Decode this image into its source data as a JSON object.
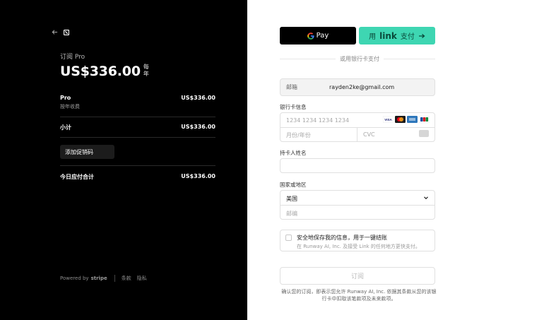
{
  "summary": {
    "subscribe_label": "订阅 Pro",
    "price": "US$336.00",
    "per": "每年",
    "items": [
      {
        "name": "Pro",
        "sub": "按年收费",
        "amount": "US$336.00"
      }
    ],
    "subtotal_label": "小计",
    "subtotal_amount": "US$336.00",
    "promo_label": "添加促销码",
    "total_label": "今日应付合计",
    "total_amount": "US$336.00"
  },
  "footer": {
    "powered_by": "Powered by",
    "stripe": "stripe",
    "terms": "条款",
    "privacy": "隐私"
  },
  "payment": {
    "gpay_label": "Pay",
    "link_prefix": "用",
    "link_brand": "link",
    "link_suffix": "支付",
    "or_text": "或用银行卡支付",
    "email_label": "邮箱",
    "email_value": "rayden2ke@gmail.com",
    "card_label": "银行卡信息",
    "card_placeholder": "1234 1234 1234 1234",
    "expiry_placeholder": "月份/年份",
    "cvc_placeholder": "CVC",
    "name_label": "持卡人姓名",
    "name_value": "",
    "country_label": "国家或地区",
    "country_value": "美国",
    "zip_placeholder": "邮编",
    "save_title": "安全地保存我的信息，用于一键结账",
    "save_desc": "在 Runway AI, Inc. 及接受 Link 的任何地方更快支付。",
    "submit_label": "订阅",
    "legal_text": "确认您的订阅，即表示您允许 Runway AI, Inc. 依据其条款从您的该银行卡中扣取该笔款项及未来款项。"
  },
  "colors": {
    "left_bg": "#000000",
    "link_green": "#3ed6b2",
    "visa": "#1a1f71",
    "mastercard": "#eb001b",
    "amex": "#2e77bb",
    "jcb": "#0b8a3a"
  }
}
